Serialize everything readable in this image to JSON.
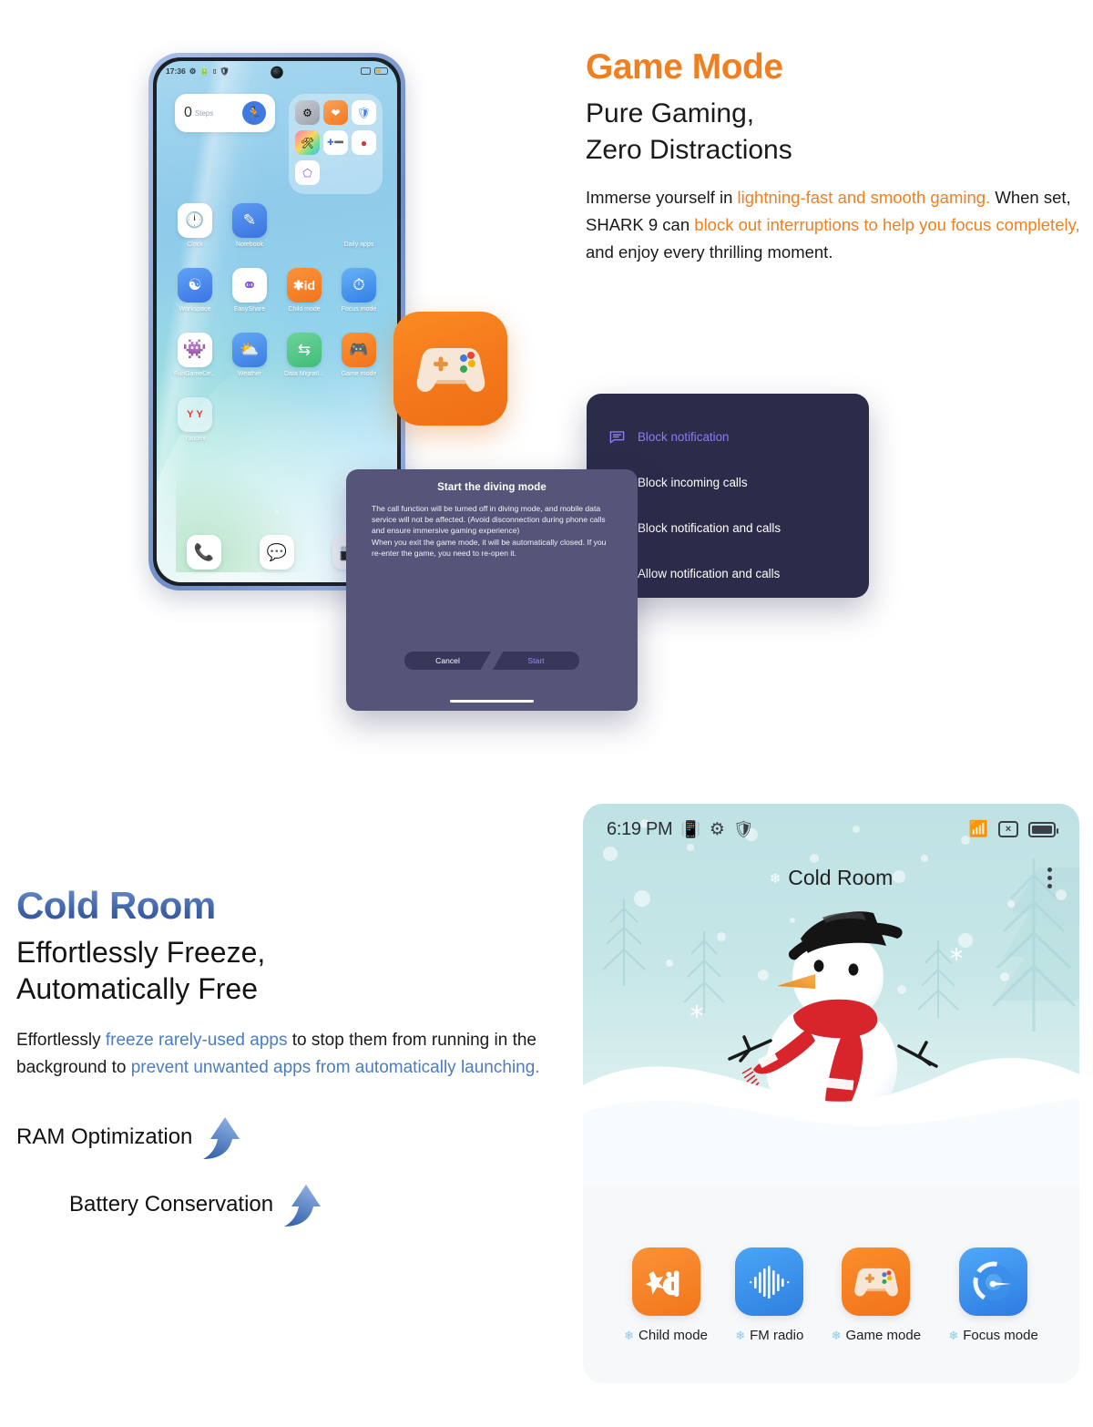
{
  "game_section": {
    "title": "Game Mode",
    "subtitle_line1": "Pure Gaming,",
    "subtitle_line2": "Zero Distractions",
    "body": {
      "seg1": "Immerse yourself in ",
      "seg2_hl": "lightning-fast and smooth gaming.",
      "seg3": " When set, SHARK 9 can ",
      "seg4_hl": "block out interruptions to help you focus completely,",
      "seg5": " and enjoy every thrilling moment."
    },
    "phone": {
      "status_bar": {
        "time": "17:36",
        "icons_left": [
          "gear-icon",
          "battery-saver-icon",
          "signal-icon",
          "shield-icon"
        ],
        "icons_right": [
          "screenshot-icon",
          "battery-icon"
        ]
      },
      "steps_widget": {
        "value": "0",
        "label": "Steps",
        "icon": "runner-icon"
      },
      "folder": {
        "label": "Daily apps"
      },
      "apps": [
        [
          {
            "label": "Clock",
            "icon": "clock-icon"
          },
          {
            "label": "Notebook",
            "icon": "pencil-icon"
          }
        ],
        [
          {
            "label": "Workspace",
            "icon": "workspace-icon"
          },
          {
            "label": "EasyShare",
            "icon": "easyshare-icon"
          },
          {
            "label": "Child mode",
            "icon": "kid-icon"
          },
          {
            "label": "Focus mode",
            "icon": "focus-icon"
          }
        ],
        [
          {
            "label": "FunGameCe...",
            "icon": "fungame-icon"
          },
          {
            "label": "Weather",
            "icon": "weather-icon"
          },
          {
            "label": "Data MigratI...",
            "icon": "data-migration-icon"
          },
          {
            "label": "Game mode",
            "icon": "gamepad-icon"
          }
        ],
        [
          {
            "label": "Yandex",
            "icon": "yandex-icon"
          }
        ]
      ],
      "dock": [
        "phone-icon",
        "messages-icon",
        "camera-icon"
      ]
    },
    "floating_icon": "game-mode-app-icon",
    "dialog": {
      "title": "Start the diving mode",
      "body": "The call function will be turned off in diving mode, and mobile data service will not be affected. (Avoid disconnection during phone calls and ensure immersive gaming experience)\nWhen you exit the game mode, it will be automatically closed. If you re-enter the game, you need to re-open it.",
      "cancel_label": "Cancel",
      "start_label": "Start"
    },
    "block_menu": {
      "items": [
        {
          "label": "Block notification",
          "icon": "chat-bubble-icon",
          "active": true
        },
        {
          "label": "Block incoming calls",
          "icon": "call-incoming-icon",
          "active": false
        },
        {
          "label": "Block notification and calls",
          "icon": "no-entry-icon",
          "active": false
        },
        {
          "label": "Allow notification and calls",
          "icon": "call-chat-icon",
          "active": false
        }
      ]
    }
  },
  "cold_section": {
    "title": "Cold Room",
    "subtitle_line1": "Effortlessly Freeze,",
    "subtitle_line2": "Automatically Free",
    "body": {
      "seg1": "Effortlessly ",
      "seg2_hl": "freeze rarely-used apps",
      "seg3": " to stop them from running in the background to ",
      "seg4_hl": "prevent unwanted apps from automatically launching."
    },
    "features": [
      {
        "label": "RAM Optimization",
        "icon": "up-arrow-icon"
      },
      {
        "label": "Battery Conservation",
        "icon": "up-arrow-icon"
      }
    ],
    "panel": {
      "status_bar": {
        "time": "6:19 PM",
        "icons_left": [
          "vibrate-icon",
          "gear-icon",
          "shield-play-icon"
        ],
        "icons_right": [
          "wifi-icon",
          "no-sim-icon",
          "battery-icon"
        ]
      },
      "room_title": "Cold Room",
      "menu_icon": "kebab-menu-icon",
      "illustration": "snowman-illustration",
      "apps": [
        {
          "label": "Child mode",
          "icon": "kid-icon"
        },
        {
          "label": "FM radio",
          "icon": "fm-radio-icon"
        },
        {
          "label": "Game mode",
          "icon": "gamepad-icon"
        },
        {
          "label": "Focus mode",
          "icon": "focus-icon"
        }
      ]
    }
  },
  "colors": {
    "orange": "#F0801F",
    "blue": "#3D62A8",
    "link_blue": "#4A7DC4",
    "menu_bg": "#2B2B4A",
    "dialog_bg": "#545579",
    "accent_purple": "#8B7DF0"
  }
}
